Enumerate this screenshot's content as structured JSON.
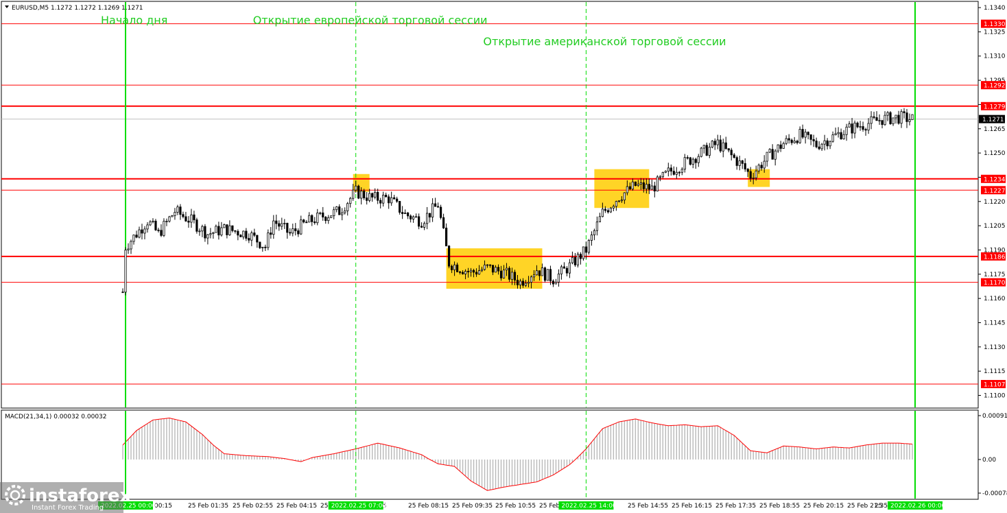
{
  "chart_data": {
    "type": "candlestick",
    "header": "EURUSD,M5  1.1272 1.1272 1.1269 1.1271",
    "symbol": "EURUSD",
    "timeframe": "M5",
    "ohlc_header": {
      "open": 1.1272,
      "high": 1.1272,
      "low": 1.1269,
      "close": 1.1271
    },
    "current_price": 1.1271,
    "ylim": [
      1.11,
      1.134
    ],
    "y_ticks": [
      1.134,
      1.1325,
      1.131,
      1.1295,
      1.128,
      1.1265,
      1.125,
      1.1235,
      1.122,
      1.1205,
      1.119,
      1.1175,
      1.116,
      1.1145,
      1.113,
      1.1115,
      1.11
    ],
    "levels": [
      {
        "value": 1.133,
        "label": "1.1330",
        "bold": false
      },
      {
        "value": 1.1292,
        "label": "1.1292",
        "bold": false
      },
      {
        "value": 1.1279,
        "label": "1.1279",
        "bold": true
      },
      {
        "value": 1.1234,
        "label": "1.1234",
        "bold": true
      },
      {
        "value": 1.1227,
        "label": "1.1227",
        "bold": false
      },
      {
        "value": 1.1186,
        "label": "1.1186",
        "bold": true
      },
      {
        "value": 1.117,
        "label": "1.1170",
        "bold": false
      },
      {
        "value": 1.1107,
        "label": "1.1107",
        "bold": false
      }
    ],
    "annotations": [
      {
        "text": "Начало дня",
        "at": "25 Feb 00:00",
        "row": 1
      },
      {
        "text": "Открытие европейской торговой сессии",
        "at": "25 Feb 07:00",
        "row": 1
      },
      {
        "text": "Открытие американской торговой сессии",
        "at": "25 Feb 14:00",
        "row": 2
      }
    ],
    "x_ticks": [
      "00:15",
      "25 Feb 01:35",
      "25 Feb 02:55",
      "25 Feb 04:15",
      "25 Feb",
      "55",
      "25 Feb 08:15",
      "25 Feb 09:35",
      "25 Feb 10:55",
      "25 Feb 12:",
      "25 Feb 14:55",
      "25 Feb 16:15",
      "25 Feb 17:35",
      "25 Feb 18:55",
      "25 Feb 20:15",
      "25 Feb 21:35",
      "25"
    ],
    "x_highlight_ticks": [
      {
        "text": "2022.02.25 00:00",
        "role": "day-start"
      },
      {
        "text": "2022.02.25 07:00",
        "role": "session"
      },
      {
        "text": "2022.02.25 14:00",
        "role": "session"
      },
      {
        "text": "2022.02.26 00:00",
        "role": "day-start"
      }
    ],
    "price_path": [
      [
        "24 Feb 23:55",
        1.1164
      ],
      [
        "25 Feb 00:00",
        1.1192
      ],
      [
        "25 Feb 00:40",
        1.1208
      ],
      [
        "25 Feb 01:00",
        1.12
      ],
      [
        "25 Feb 01:30",
        1.1214
      ],
      [
        "25 Feb 02:00",
        1.1208
      ],
      [
        "25 Feb 02:30",
        1.12
      ],
      [
        "25 Feb 03:00",
        1.1203
      ],
      [
        "25 Feb 03:45",
        1.12
      ],
      [
        "25 Feb 04:15",
        1.1192
      ],
      [
        "25 Feb 04:30",
        1.1208
      ],
      [
        "25 Feb 05:00",
        1.12
      ],
      [
        "25 Feb 05:30",
        1.1207
      ],
      [
        "25 Feb 06:00",
        1.1211
      ],
      [
        "25 Feb 06:30",
        1.1214
      ],
      [
        "25 Feb 07:00",
        1.1226
      ],
      [
        "25 Feb 07:30",
        1.1222
      ],
      [
        "25 Feb 08:00",
        1.1222
      ],
      [
        "25 Feb 08:30",
        1.1212
      ],
      [
        "25 Feb 09:00",
        1.1208
      ],
      [
        "25 Feb 09:30",
        1.1218
      ],
      [
        "25 Feb 09:50",
        1.1182
      ],
      [
        "25 Feb 10:30",
        1.1176
      ],
      [
        "25 Feb 11:00",
        1.1179
      ],
      [
        "25 Feb 11:30",
        1.1176
      ],
      [
        "25 Feb 12:00",
        1.117
      ],
      [
        "25 Feb 12:30",
        1.1178
      ],
      [
        "25 Feb 13:00",
        1.1172
      ],
      [
        "25 Feb 13:30",
        1.118
      ],
      [
        "25 Feb 14:00",
        1.119
      ],
      [
        "25 Feb 14:30",
        1.1213
      ],
      [
        "25 Feb 15:00",
        1.1223
      ],
      [
        "25 Feb 15:30",
        1.123
      ],
      [
        "25 Feb 16:00",
        1.1228
      ],
      [
        "25 Feb 16:30",
        1.1238
      ],
      [
        "25 Feb 17:00",
        1.1244
      ],
      [
        "25 Feb 17:30",
        1.125
      ],
      [
        "25 Feb 18:00",
        1.1256
      ],
      [
        "25 Feb 18:45",
        1.1242
      ],
      [
        "25 Feb 19:00",
        1.1236
      ],
      [
        "25 Feb 19:30",
        1.1247
      ],
      [
        "25 Feb 20:00",
        1.1256
      ],
      [
        "25 Feb 20:30",
        1.1261
      ],
      [
        "25 Feb 21:00",
        1.1255
      ],
      [
        "25 Feb 21:30",
        1.126
      ],
      [
        "25 Feb 22:00",
        1.1265
      ],
      [
        "25 Feb 22:30",
        1.1268
      ],
      [
        "25 Feb 23:00",
        1.1271
      ],
      [
        "25 Feb 23:30",
        1.1272
      ],
      [
        "25 Feb 23:55",
        1.1271
      ]
    ],
    "highlight_zones": [
      {
        "from": "25 Feb 06:55",
        "to": "25 Feb 07:25",
        "low": 1.1226,
        "high": 1.1237
      },
      {
        "from": "25 Feb 09:45",
        "to": "25 Feb 12:40",
        "low": 1.1166,
        "high": 1.1191
      },
      {
        "from": "25 Feb 14:15",
        "to": "25 Feb 15:55",
        "low": 1.1216,
        "high": 1.124
      },
      {
        "from": "25 Feb 18:55",
        "to": "25 Feb 19:35",
        "low": 1.1229,
        "high": 1.124
      }
    ],
    "indicator": {
      "label": "MACD(21,34,1) 0.00032 0.00032",
      "name": "MACD",
      "params": [
        21,
        34,
        1
      ],
      "value": 0.00032,
      "signal": 0.00032,
      "ylim": [
        -0.00078,
        0.00091
      ],
      "y_ticks": [
        0.00091,
        0.0,
        -0.00078
      ],
      "y_tick_labels": [
        "0.00091",
        "0.00",
        "-0.00078"
      ],
      "path": [
        [
          "24 Feb 23:55",
          0.0003
        ],
        [
          "25 Feb 00:20",
          0.0006
        ],
        [
          "25 Feb 00:50",
          0.00082
        ],
        [
          "25 Feb 01:20",
          0.00086
        ],
        [
          "25 Feb 01:50",
          0.00078
        ],
        [
          "25 Feb 02:20",
          0.00052
        ],
        [
          "25 Feb 02:40",
          0.0003
        ],
        [
          "25 Feb 03:00",
          0.00012
        ],
        [
          "25 Feb 03:40",
          8e-05
        ],
        [
          "25 Feb 04:20",
          6e-05
        ],
        [
          "25 Feb 04:50",
          2e-05
        ],
        [
          "25 Feb 05:20",
          -5e-05
        ],
        [
          "25 Feb 05:40",
          4e-05
        ],
        [
          "25 Feb 06:20",
          0.00012
        ],
        [
          "25 Feb 07:00",
          0.00022
        ],
        [
          "25 Feb 07:40",
          0.00034
        ],
        [
          "25 Feb 08:20",
          0.00024
        ],
        [
          "25 Feb 09:00",
          0.0001
        ],
        [
          "25 Feb 09:30",
          -0.0001
        ],
        [
          "25 Feb 10:00",
          -0.00016
        ],
        [
          "25 Feb 10:30",
          -0.0005
        ],
        [
          "25 Feb 11:00",
          -0.00072
        ],
        [
          "25 Feb 11:30",
          -0.00064
        ],
        [
          "25 Feb 12:00",
          -0.00058
        ],
        [
          "25 Feb 12:30",
          -0.00052
        ],
        [
          "25 Feb 13:00",
          -0.00036
        ],
        [
          "25 Feb 13:30",
          -0.00012
        ],
        [
          "25 Feb 14:00",
          0.00022
        ],
        [
          "25 Feb 14:30",
          0.00064
        ],
        [
          "25 Feb 15:00",
          0.00078
        ],
        [
          "25 Feb 15:30",
          0.00084
        ],
        [
          "25 Feb 16:00",
          0.00076
        ],
        [
          "25 Feb 16:30",
          0.0007
        ],
        [
          "25 Feb 17:00",
          0.00072
        ],
        [
          "25 Feb 17:30",
          0.00068
        ],
        [
          "25 Feb 18:00",
          0.0007
        ],
        [
          "25 Feb 18:30",
          0.0005
        ],
        [
          "25 Feb 19:00",
          0.00018
        ],
        [
          "25 Feb 19:30",
          0.00014
        ],
        [
          "25 Feb 20:00",
          0.00028
        ],
        [
          "25 Feb 20:30",
          0.00026
        ],
        [
          "25 Feb 21:00",
          0.00022
        ],
        [
          "25 Feb 21:30",
          0.00026
        ],
        [
          "25 Feb 22:00",
          0.00024
        ],
        [
          "25 Feb 22:30",
          0.0003
        ],
        [
          "25 Feb 23:00",
          0.00034
        ],
        [
          "25 Feb 23:30",
          0.00034
        ],
        [
          "25 Feb 23:55",
          0.00032
        ]
      ]
    },
    "colors": {
      "background": "#ffffff",
      "candle": "#000000",
      "level": "#ff0000",
      "zone": "#ffcc00",
      "day_line": "#00dd00",
      "annotation": "#22cc22",
      "histogram": "#b8b8b8",
      "signal": "#ff0000",
      "label_bg": "#ff0000",
      "current_price_bg": "#000000",
      "axis": "#000000"
    }
  },
  "watermark": {
    "brand": "instaforex",
    "tagline": "Instant Forex Trading"
  }
}
